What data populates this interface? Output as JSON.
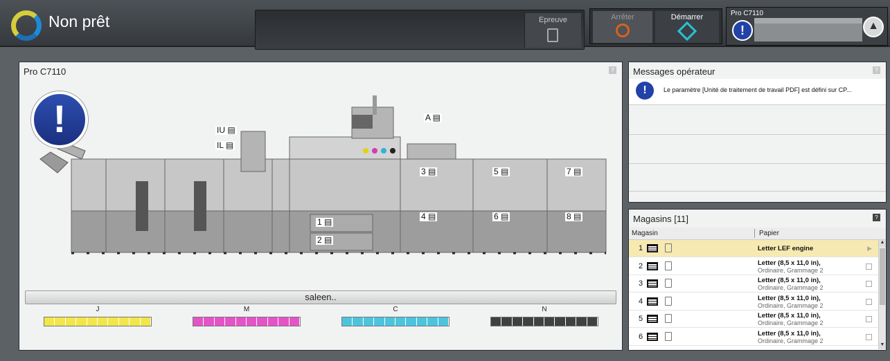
{
  "header": {
    "status": "Non prêt",
    "proof_label": "Epreuve",
    "stop_label": "Arrêter",
    "start_label": "Démarrer",
    "printer_name": "Pro C7110"
  },
  "main": {
    "title": "Pro C7110",
    "marker_text": "saleen..",
    "tray_tags": [
      "IU",
      "IL",
      "A",
      "1",
      "2",
      "3",
      "4",
      "5",
      "6",
      "7",
      "8"
    ],
    "toners": [
      {
        "label": "J",
        "color": "#f2e64a"
      },
      {
        "label": "M",
        "color": "#e454c6"
      },
      {
        "label": "C",
        "color": "#4cc4dd"
      },
      {
        "label": "N",
        "color": "#404040"
      }
    ]
  },
  "messages": {
    "title": "Messages opérateur",
    "items": [
      "Le paramètre [Unité de traitement de travail PDF] est défini sur CP..."
    ]
  },
  "trays": {
    "title": "Magasins [11]",
    "col_tray": "Magasin",
    "col_paper": "Papier",
    "rows": [
      {
        "num": "1",
        "title": "Letter LEF engine",
        "sub": ""
      },
      {
        "num": "2",
        "title": "Letter (8,5 x 11,0 in),",
        "sub": "Ordinaire, Grammage 2"
      },
      {
        "num": "3",
        "title": "Letter (8,5 x 11,0 in),",
        "sub": "Ordinaire, Grammage 2"
      },
      {
        "num": "4",
        "title": "Letter (8,5 x 11,0 in),",
        "sub": "Ordinaire, Grammage 2"
      },
      {
        "num": "5",
        "title": "Letter (8,5 x 11,0 in),",
        "sub": "Ordinaire, Grammage 2"
      },
      {
        "num": "6",
        "title": "Letter (8,5 x 11,0 in),",
        "sub": "Ordinaire, Grammage 2"
      }
    ]
  }
}
